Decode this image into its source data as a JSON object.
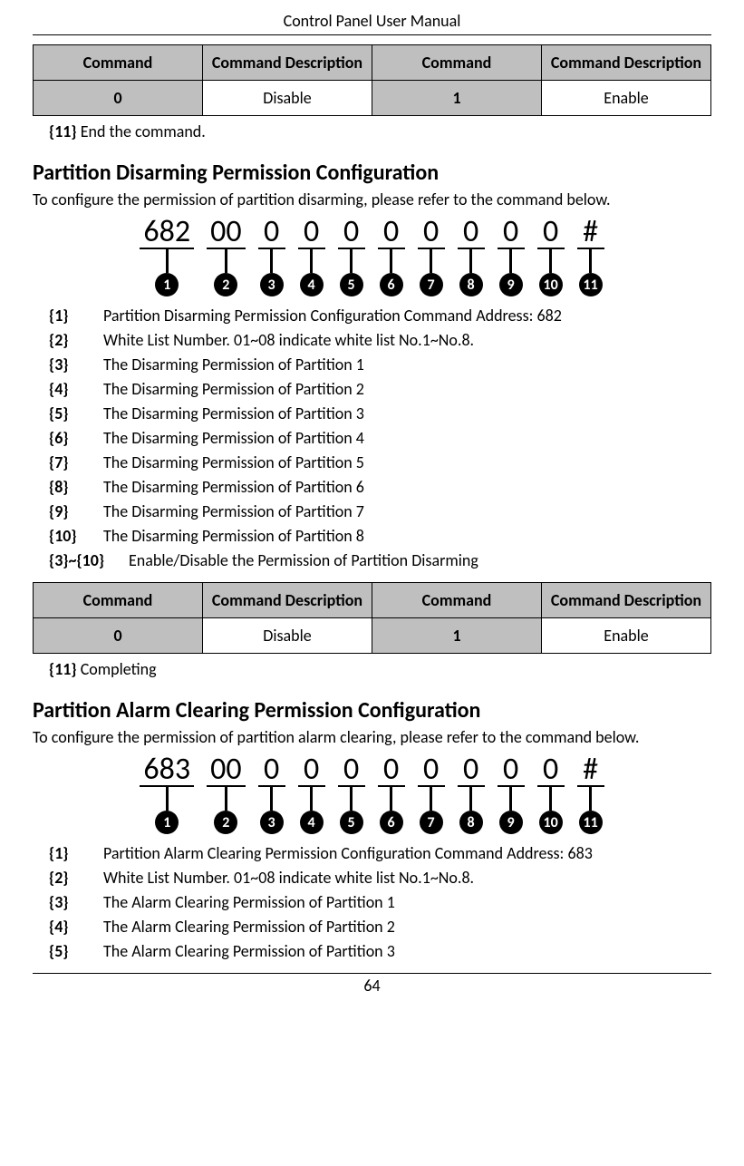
{
  "header": {
    "title": "Control Panel User Manual"
  },
  "footer": {
    "page": "64"
  },
  "table_headers": {
    "c1": "Command",
    "c2": "Command Description",
    "c3": "Command",
    "c4": "Command Description"
  },
  "table1": {
    "r1c1": "0",
    "r1c2": "Disable",
    "r1c3": "1",
    "r1c4": "Enable"
  },
  "note_top": {
    "tag": "{11}",
    "text": "End the command."
  },
  "section1": {
    "title": "Partition Disarming Permission Configuration",
    "intro": "To configure the permission of partition disarming, please refer to the command below.",
    "segments": [
      "682",
      "00",
      "0",
      "0",
      "0",
      "0",
      "0",
      "0",
      "0",
      "0",
      "#"
    ],
    "markers": [
      "1",
      "2",
      "3",
      "4",
      "5",
      "6",
      "7",
      "8",
      "9",
      "10",
      "11"
    ],
    "desc": [
      {
        "tag": "{1}",
        "text": "Partition Disarming Permission Configuration Command Address: 682"
      },
      {
        "tag": "{2}",
        "text": "White List Number. 01~08 indicate white list No.1~No.8."
      },
      {
        "tag": "{3}",
        "text": "The Disarming Permission of Partition 1"
      },
      {
        "tag": "{4}",
        "text": "The Disarming Permission of Partition 2"
      },
      {
        "tag": "{5}",
        "text": "The Disarming Permission of Partition 3"
      },
      {
        "tag": "{6}",
        "text": "The Disarming Permission of Partition 4"
      },
      {
        "tag": "{7}",
        "text": "The Disarming Permission of Partition 5"
      },
      {
        "tag": "{8}",
        "text": "The Disarming Permission of Partition 6"
      },
      {
        "tag": "{9}",
        "text": "The Disarming Permission of Partition 7"
      },
      {
        "tag": "{10}",
        "text": "The Disarming Permission of Partition 8"
      },
      {
        "tag": "{3}~{10}",
        "text": "Enable/Disable the Permission of Partition Disarming"
      }
    ],
    "table_headers2": {
      "c1": "Command",
      "c2": "Command Description",
      "c3": "Command",
      "c4": "Command Description"
    },
    "table2": {
      "r1c1": "0",
      "r1c2": "Disable",
      "r1c3": "1",
      "r1c4": "Enable"
    },
    "note_bottom": {
      "tag": "{11}",
      "text": "Completing"
    }
  },
  "section2": {
    "title": "Partition Alarm Clearing Permission Configuration",
    "intro": "To configure the permission of partition alarm clearing, please refer to the command below.",
    "segments": [
      "683",
      "00",
      "0",
      "0",
      "0",
      "0",
      "0",
      "0",
      "0",
      "0",
      "#"
    ],
    "markers": [
      "1",
      "2",
      "3",
      "4",
      "5",
      "6",
      "7",
      "8",
      "9",
      "10",
      "11"
    ],
    "desc": [
      {
        "tag": "{1}",
        "text": "Partition Alarm Clearing Permission Configuration Command Address: 683"
      },
      {
        "tag": "{2}",
        "text": "White List Number. 01~08 indicate white list No.1~No.8."
      },
      {
        "tag": "{3}",
        "text": "The Alarm Clearing Permission of Partition 1"
      },
      {
        "tag": "{4}",
        "text": "The Alarm Clearing Permission of Partition 2"
      },
      {
        "tag": "{5}",
        "text": "The Alarm Clearing Permission of Partition 3"
      }
    ]
  }
}
